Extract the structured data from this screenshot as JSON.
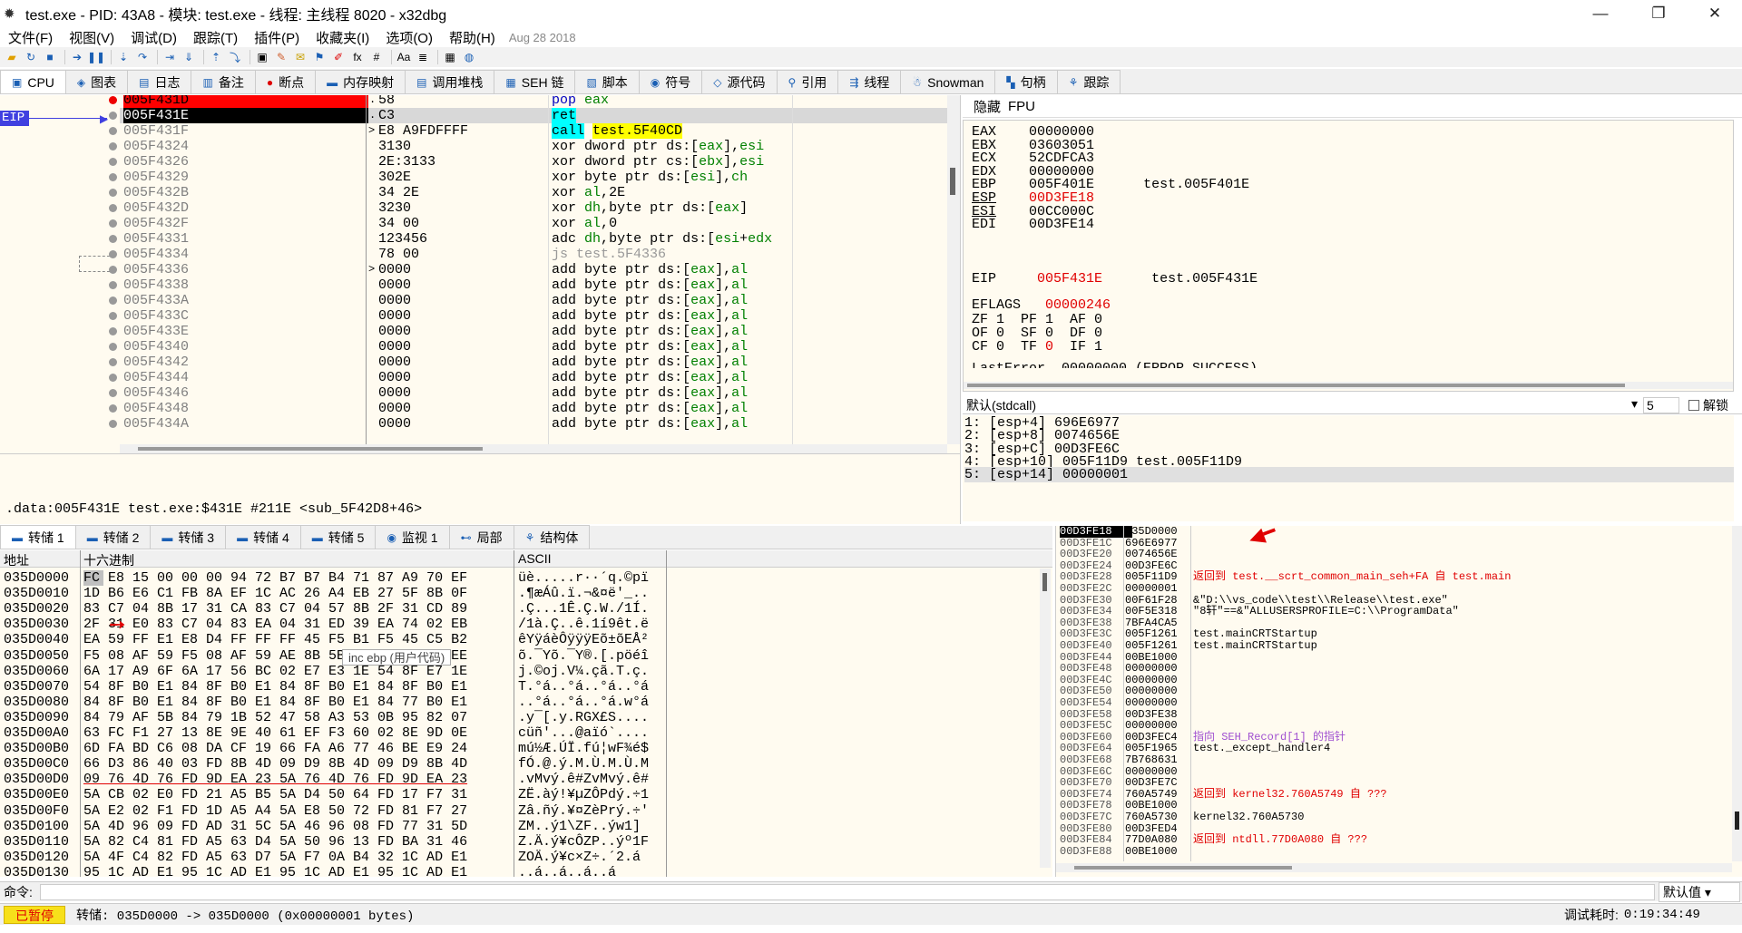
{
  "window": {
    "title": "test.exe - PID: 43A8 - 模块: test.exe - 线程: 主线程 8020 - x32dbg",
    "minimize": "—",
    "maximize": "❐",
    "close": "✕"
  },
  "menu": [
    "文件(F)",
    "视图(V)",
    "调试(D)",
    "跟踪(T)",
    "插件(P)",
    "收藏夹(I)",
    "选项(O)",
    "帮助(H)"
  ],
  "menu_date": "Aug 28 2018",
  "tabs": [
    {
      "label": "CPU",
      "icon": "cpu-icon"
    },
    {
      "label": "图表",
      "icon": "graph-icon"
    },
    {
      "label": "日志",
      "icon": "log-icon"
    },
    {
      "label": "备注",
      "icon": "notes-icon"
    },
    {
      "label": "断点",
      "icon": "breakpoint-icon"
    },
    {
      "label": "内存映射",
      "icon": "memory-map-icon"
    },
    {
      "label": "调用堆栈",
      "icon": "call-stack-icon"
    },
    {
      "label": "SEH 链",
      "icon": "seh-icon"
    },
    {
      "label": "脚本",
      "icon": "script-icon"
    },
    {
      "label": "符号",
      "icon": "symbols-icon"
    },
    {
      "label": "源代码",
      "icon": "source-icon"
    },
    {
      "label": "引用",
      "icon": "references-icon"
    },
    {
      "label": "线程",
      "icon": "threads-icon"
    },
    {
      "label": "Snowman",
      "icon": "snowman-icon"
    },
    {
      "label": "句柄",
      "icon": "handles-icon"
    },
    {
      "label": "跟踪",
      "icon": "trace-icon"
    }
  ],
  "eip_label": "EIP",
  "disasm": [
    {
      "addr": "005F431D",
      "bytes": "58",
      "ins": "pop eax",
      "hl": "bp"
    },
    {
      "addr": "005F431E",
      "bytes": "C3",
      "ins": "ret",
      "hl": "eip"
    },
    {
      "addr": "005F431F",
      "bytes": "E8 A9FDFFFF",
      "ins": "call test.5F40CD",
      "hl": "call"
    },
    {
      "addr": "005F4324",
      "bytes": "3130",
      "ins": "xor dword ptr ds:[eax],esi"
    },
    {
      "addr": "005F4326",
      "bytes": "2E:3133",
      "ins": "xor dword ptr cs:[ebx],esi"
    },
    {
      "addr": "005F4329",
      "bytes": "302E",
      "ins": "xor byte ptr ds:[esi],ch"
    },
    {
      "addr": "005F432B",
      "bytes": "34 2E",
      "ins": "xor al,2E"
    },
    {
      "addr": "005F432D",
      "bytes": "3230",
      "ins": "xor dh,byte ptr ds:[eax]"
    },
    {
      "addr": "005F432F",
      "bytes": "34 00",
      "ins": "xor al,0"
    },
    {
      "addr": "005F4331",
      "bytes": "123456",
      "ins": "adc dh,byte ptr ds:[esi+edx"
    },
    {
      "addr": "005F4334",
      "bytes": "78 00",
      "ins": "js test.5F4336"
    },
    {
      "addr": "005F4336",
      "bytes": "0000",
      "ins": "add byte ptr ds:[eax],al"
    },
    {
      "addr": "005F4338",
      "bytes": "0000",
      "ins": "add byte ptr ds:[eax],al"
    },
    {
      "addr": "005F433A",
      "bytes": "0000",
      "ins": "add byte ptr ds:[eax],al"
    },
    {
      "addr": "005F433C",
      "bytes": "0000",
      "ins": "add byte ptr ds:[eax],al"
    },
    {
      "addr": "005F433E",
      "bytes": "0000",
      "ins": "add byte ptr ds:[eax],al"
    },
    {
      "addr": "005F4340",
      "bytes": "0000",
      "ins": "add byte ptr ds:[eax],al"
    },
    {
      "addr": "005F4342",
      "bytes": "0000",
      "ins": "add byte ptr ds:[eax],al"
    },
    {
      "addr": "005F4344",
      "bytes": "0000",
      "ins": "add byte ptr ds:[eax],al"
    },
    {
      "addr": "005F4346",
      "bytes": "0000",
      "ins": "add byte ptr ds:[eax],al"
    },
    {
      "addr": "005F4348",
      "bytes": "0000",
      "ins": "add byte ptr ds:[eax],al"
    },
    {
      "addr": "005F434A",
      "bytes": "0000",
      "ins": "add byte ptr ds:[eax],al"
    }
  ],
  "infobar": ".data:005F431E test.exe:$431E #211E <sub_5F42D8+46>",
  "regs_header": {
    "hide": "隐藏",
    "fpu": "FPU"
  },
  "regs": [
    {
      "name": "EAX",
      "val": "00000000",
      "info": ""
    },
    {
      "name": "EBX",
      "val": "03603051",
      "info": ""
    },
    {
      "name": "ECX",
      "val": "52CDFCA3",
      "info": ""
    },
    {
      "name": "EDX",
      "val": "00000000",
      "info": ""
    },
    {
      "name": "EBP",
      "val": "005F401E",
      "info": "test.005F401E"
    },
    {
      "name": "ESP",
      "val": "00D3FE18",
      "info": "",
      "red": true
    },
    {
      "name": "ESI",
      "val": "00CC000C",
      "info": ""
    },
    {
      "name": "EDI",
      "val": "00D3FE14",
      "info": ""
    }
  ],
  "eip_reg": {
    "name": "EIP",
    "val": "005F431E",
    "info": "test.005F431E"
  },
  "eflags": {
    "name": "EFLAGS",
    "val": "00000246"
  },
  "flags": [
    "ZF 1  PF 1  AF 0",
    "OF 0  SF 0  DF 0",
    "CF 0  TF 0  IF 1"
  ],
  "lasterror": "LastError  00000000 (ERROR_SUCCESS)",
  "args_bar": {
    "convention": "默认(stdcall)",
    "count": "5",
    "unlock": "解锁"
  },
  "args": [
    "1: [esp+4] 696E6977",
    "2: [esp+8] 0074656E",
    "3: [esp+C] 00D3FE6C",
    "4: [esp+10] 005F11D9 test.005F11D9",
    "5: [esp+14] 00000001"
  ],
  "dump_tabs": [
    "转储 1",
    "转储 2",
    "转储 3",
    "转储 4",
    "转储 5",
    "监视 1",
    "局部",
    "结构体"
  ],
  "dump_hdr": {
    "addr": "地址",
    "hex": "十六进制",
    "ascii": "ASCII"
  },
  "dump": [
    {
      "a": "035D0000",
      "h": "FC E8 15 00 00 00 94 72 B7 B7 B4 71 87 A9 70 EF",
      "s": "üè.....r··´q.©pï"
    },
    {
      "a": "035D0010",
      "h": "1D B6 E6 C1 FB 8A EF 1C AC 26 A4 EB 27 5F 8B 0F",
      "s": ".¶æÁû.ï.¬&¤ë'_.."
    },
    {
      "a": "035D0020",
      "h": "83 C7 04 8B 17 31 CA 83 C7 04 57 8B 2F 31 CD 89",
      "s": ".Ç...1Ê.Ç.W./1Í."
    },
    {
      "a": "035D0030",
      "h": "2F 31 E0 83 C7 04 83 EA 04 31 ED 39 EA 74 02 EB",
      "s": "/1à.Ç..ê.1í9êt.ë"
    },
    {
      "a": "035D0040",
      "h": "EA 59 FF E1 E8 D4 FF FF FF 45 F5 B1 F5 45 C5 B2",
      "s": "êYÿáèÔÿÿÿEõ±õEÅ²"
    },
    {
      "a": "035D0050",
      "h": "F5 08 AF 59 F5 08 AF 59 AE 8B 5B 8F 70 F6 E9 EE",
      "s": "õ.¯Yõ.¯Y®.[.pöéî"
    },
    {
      "a": "035D0060",
      "h": "6A 17 A9 6F 6A 17 56 BC 02 E7 E3 1E 54 8F E7 1E",
      "s": "j.©oj.V¼.çã.T.ç."
    },
    {
      "a": "035D0070",
      "h": "54 8F B0 E1 84 8F B0 E1 84 8F B0 E1 84 8F B0 E1",
      "s": "T.°á..°á..°á..°á"
    },
    {
      "a": "035D0080",
      "h": "84 8F B0 E1 84 8F B0 E1 84 8F B0 E1 84 77 B0 E1",
      "s": "..°á..°á..°á.w°á"
    },
    {
      "a": "035D0090",
      "h": "84 79 AF 5B 84 79 1B 52 47 58 A3 53 0B 95 82 07",
      "s": ".y¯[.y.RGX£S...."
    },
    {
      "a": "035D00A0",
      "h": "63 FC F1 27 13 8E 9E 40 61 EF F3 60 02 8E 9D 0E",
      "s": "cüñ'...@aïó`...."
    },
    {
      "a": "035D00B0",
      "h": "6D FA BD C6 08 DA CF 19 66 FA A6 77 46 BE E9 24",
      "s": "mú½Æ.ÚÏ.fú¦wF¾é$"
    },
    {
      "a": "035D00C0",
      "h": "66 D3 86 40 03 FD 8B 4D 09 D9 8B 4D 09 D9 8B 4D",
      "s": "fÓ.@.ý.M.Ù.M.Ù.M"
    },
    {
      "a": "035D00D0",
      "h": "09 76 4D 76 FD 9D EA 23 5A 76 4D 76 FD 9D EA 23",
      "s": ".vMvý.ê#ZvMvý.ê#"
    },
    {
      "a": "035D00E0",
      "h": "5A CB 02 E0 FD 21 A5 B5 5A D4 50 64 FD 17 F7 31",
      "s": "ZË.àý!¥µZÔPdý.÷1"
    },
    {
      "a": "035D00F0",
      "h": "5A E2 02 F1 FD 1D A5 A4 5A E8 50 72 FD 81 F7 27",
      "s": "Zâ.ñý.¥¤ZèPrý.÷'"
    },
    {
      "a": "035D0100",
      "h": "5A 4D 96 09 FD AD 31 5C 5A 46 96 08 FD 77 31 5D",
      "s": "ZM..ý­1\\ZF..ýw1]"
    },
    {
      "a": "035D0110",
      "h": "5A 82 C4 81 FD A5 63 D4 5A 50 96 13 FD BA 31 46",
      "s": "Z.Ä.ý¥cÔZP..ýº1F"
    },
    {
      "a": "035D0120",
      "h": "5A 4F C4 82 FD A5 63 D7 5A F7 0A B4 32 1C AD E1",
      "s": "ZOÄ.ý¥c×Z÷.´2.­á"
    },
    {
      "a": "035D0130",
      "h": "95 1C AD E1 95 1C AD E1 95 1C AD E1 95 1C AD E1",
      "s": "..­á..­á..­á..­á"
    }
  ],
  "tooltip": "inc ebp (用户代码)",
  "stack": [
    {
      "a": "00D3FE18",
      "v": "035D0000",
      "c": "",
      "top": true
    },
    {
      "a": "00D3FE1C",
      "v": "696E6977",
      "c": ""
    },
    {
      "a": "00D3FE20",
      "v": "0074656E",
      "c": ""
    },
    {
      "a": "00D3FE24",
      "v": "00D3FE6C",
      "c": ""
    },
    {
      "a": "00D3FE28",
      "v": "005F11D9",
      "c": "返回到 test.__scrt_common_main_seh+FA 自 test.main",
      "red": true
    },
    {
      "a": "00D3FE2C",
      "v": "00000001",
      "c": ""
    },
    {
      "a": "00D3FE30",
      "v": "00F61F28",
      "c": "&\"D:\\\\vs_code\\\\test\\\\Release\\\\test.exe\""
    },
    {
      "a": "00D3FE34",
      "v": "00F5E318",
      "c": "\"8轩\"==&\"ALLUSERSPROFILE=C:\\\\ProgramData\""
    },
    {
      "a": "00D3FE38",
      "v": "7BFA4CA5",
      "c": ""
    },
    {
      "a": "00D3FE3C",
      "v": "005F1261",
      "c": "test.mainCRTStartup"
    },
    {
      "a": "00D3FE40",
      "v": "005F1261",
      "c": "test.mainCRTStartup"
    },
    {
      "a": "00D3FE44",
      "v": "00BE1000",
      "c": ""
    },
    {
      "a": "00D3FE48",
      "v": "00000000",
      "c": ""
    },
    {
      "a": "00D3FE4C",
      "v": "00000000",
      "c": ""
    },
    {
      "a": "00D3FE50",
      "v": "00000000",
      "c": ""
    },
    {
      "a": "00D3FE54",
      "v": "00000000",
      "c": ""
    },
    {
      "a": "00D3FE58",
      "v": "00D3FE38",
      "c": ""
    },
    {
      "a": "00D3FE5C",
      "v": "00000000",
      "c": ""
    },
    {
      "a": "00D3FE60",
      "v": "00D3FEC4",
      "c": "指向 SEH_Record[1] 的指针",
      "purple": true
    },
    {
      "a": "00D3FE64",
      "v": "005F1965",
      "c": "test._except_handler4"
    },
    {
      "a": "00D3FE68",
      "v": "7B768631",
      "c": ""
    },
    {
      "a": "00D3FE6C",
      "v": "00000000",
      "c": ""
    },
    {
      "a": "00D3FE70",
      "v": "00D3FE7C",
      "c": ""
    },
    {
      "a": "00D3FE74",
      "v": "760A5749",
      "c": "返回到 kernel32.760A5749 自 ???",
      "red": true
    },
    {
      "a": "00D3FE78",
      "v": "00BE1000",
      "c": ""
    },
    {
      "a": "00D3FE7C",
      "v": "760A5730",
      "c": "kernel32.760A5730"
    },
    {
      "a": "00D3FE80",
      "v": "00D3FED4",
      "c": ""
    },
    {
      "a": "00D3FE84",
      "v": "77D0A080",
      "c": "返回到 ntdll.77D0A080 自 ???",
      "red": true
    },
    {
      "a": "00D3FE88",
      "v": "00BE1000",
      "c": ""
    }
  ],
  "cmd": {
    "label": "命令:",
    "default": "默认值"
  },
  "status": {
    "paused": "已暂停",
    "msg": "转储: 035D0000 -> 035D0000 (0x00000001 bytes)",
    "time_label": "调试耗时:",
    "time": "0:19:34:49"
  }
}
